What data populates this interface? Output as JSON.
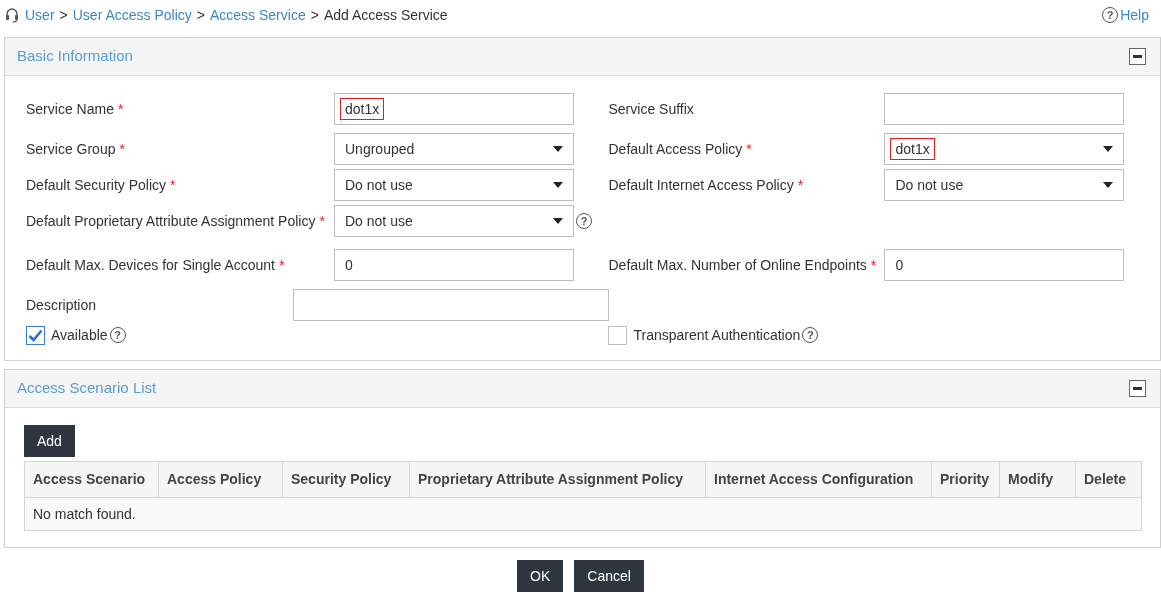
{
  "breadcrumb": [
    {
      "text": "User",
      "link": true
    },
    {
      "separator": ">",
      "text": "User Access Policy",
      "link": true
    },
    {
      "separator": ">",
      "text": "Access Service",
      "link": true
    },
    {
      "separator": ">",
      "text": "Add Access Service",
      "link": false
    }
  ],
  "help": {
    "icon": "?",
    "label": "Help"
  },
  "basic_information": {
    "title": "Basic Information",
    "expanded": true,
    "rows": [
      {
        "cells": [
          {
            "kind": "text",
            "label": "Service Name",
            "required_mark": "*",
            "value": "dot1x",
            "highlighted": true
          },
          {
            "kind": "text",
            "label": "Service Suffix"
          }
        ]
      },
      {
        "cells": [
          {
            "kind": "select",
            "label": "Service Group",
            "required_mark": "*",
            "value": "Ungrouped"
          },
          {
            "kind": "select",
            "label": "Default Access Policy",
            "required_mark": "*",
            "value": "dot1x",
            "highlighted": true
          }
        ]
      },
      {
        "cells": [
          {
            "kind": "select",
            "label": "Default Security Policy",
            "required_mark": "*",
            "value": "Do not use"
          },
          {
            "kind": "select",
            "label": "Default Internet Access Policy",
            "required_mark": "*",
            "value": "Do not use"
          }
        ]
      },
      {
        "cells": [
          {
            "kind": "select",
            "label": "Default Proprietary Attribute Assignment Policy",
            "required_mark": "*",
            "value": "Do not use",
            "help": "?"
          }
        ]
      },
      {
        "cells": [
          {
            "kind": "text",
            "label": "Default Max. Devices for Single Account",
            "required_mark": "*",
            "value": "0"
          },
          {
            "kind": "text",
            "label": "Default Max. Number of Online Endpoints",
            "required_mark": "*",
            "value": "0"
          }
        ]
      },
      {
        "cells": [
          {
            "kind": "wide_text",
            "label": "Description"
          }
        ]
      }
    ],
    "checkboxes": [
      {
        "label": "Available",
        "checked": true,
        "help": "?"
      },
      {
        "label": "Transparent Authentication",
        "checked": false,
        "help": "?"
      }
    ]
  },
  "access_scenario_list": {
    "title": "Access Scenario List",
    "expanded": true,
    "add_button": "Add",
    "table": {
      "columns": [
        "Access Scenario",
        "Access Policy",
        "Security Policy",
        "Proprietary Attribute Assignment Policy",
        "Internet Access Configuration",
        "Priority",
        "Modify",
        "Delete"
      ],
      "empty_text": "No match found."
    }
  },
  "buttons": [
    "OK",
    "Cancel"
  ]
}
